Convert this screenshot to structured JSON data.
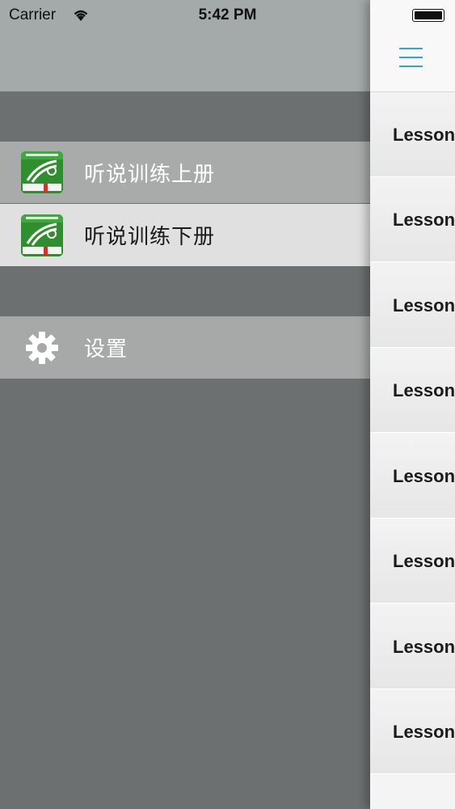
{
  "status_bar": {
    "carrier": "Carrier",
    "time": "5:42 PM"
  },
  "drawer": {
    "items": [
      {
        "label": "听说训练上册",
        "icon": "book-icon"
      },
      {
        "label": "听说训练下册",
        "icon": "book-icon"
      }
    ],
    "settings": {
      "label": "设置",
      "icon": "gear-icon"
    }
  },
  "main": {
    "menu_icon": "hamburger-menu-icon",
    "accent": "#2aa8d8",
    "lessons": [
      {
        "label": "Lesson"
      },
      {
        "label": "Lesson"
      },
      {
        "label": "Lesson"
      },
      {
        "label": "Lesson"
      },
      {
        "label": "Lesson"
      },
      {
        "label": "Lesson"
      },
      {
        "label": "Lesson"
      },
      {
        "label": "Lesson"
      }
    ]
  }
}
